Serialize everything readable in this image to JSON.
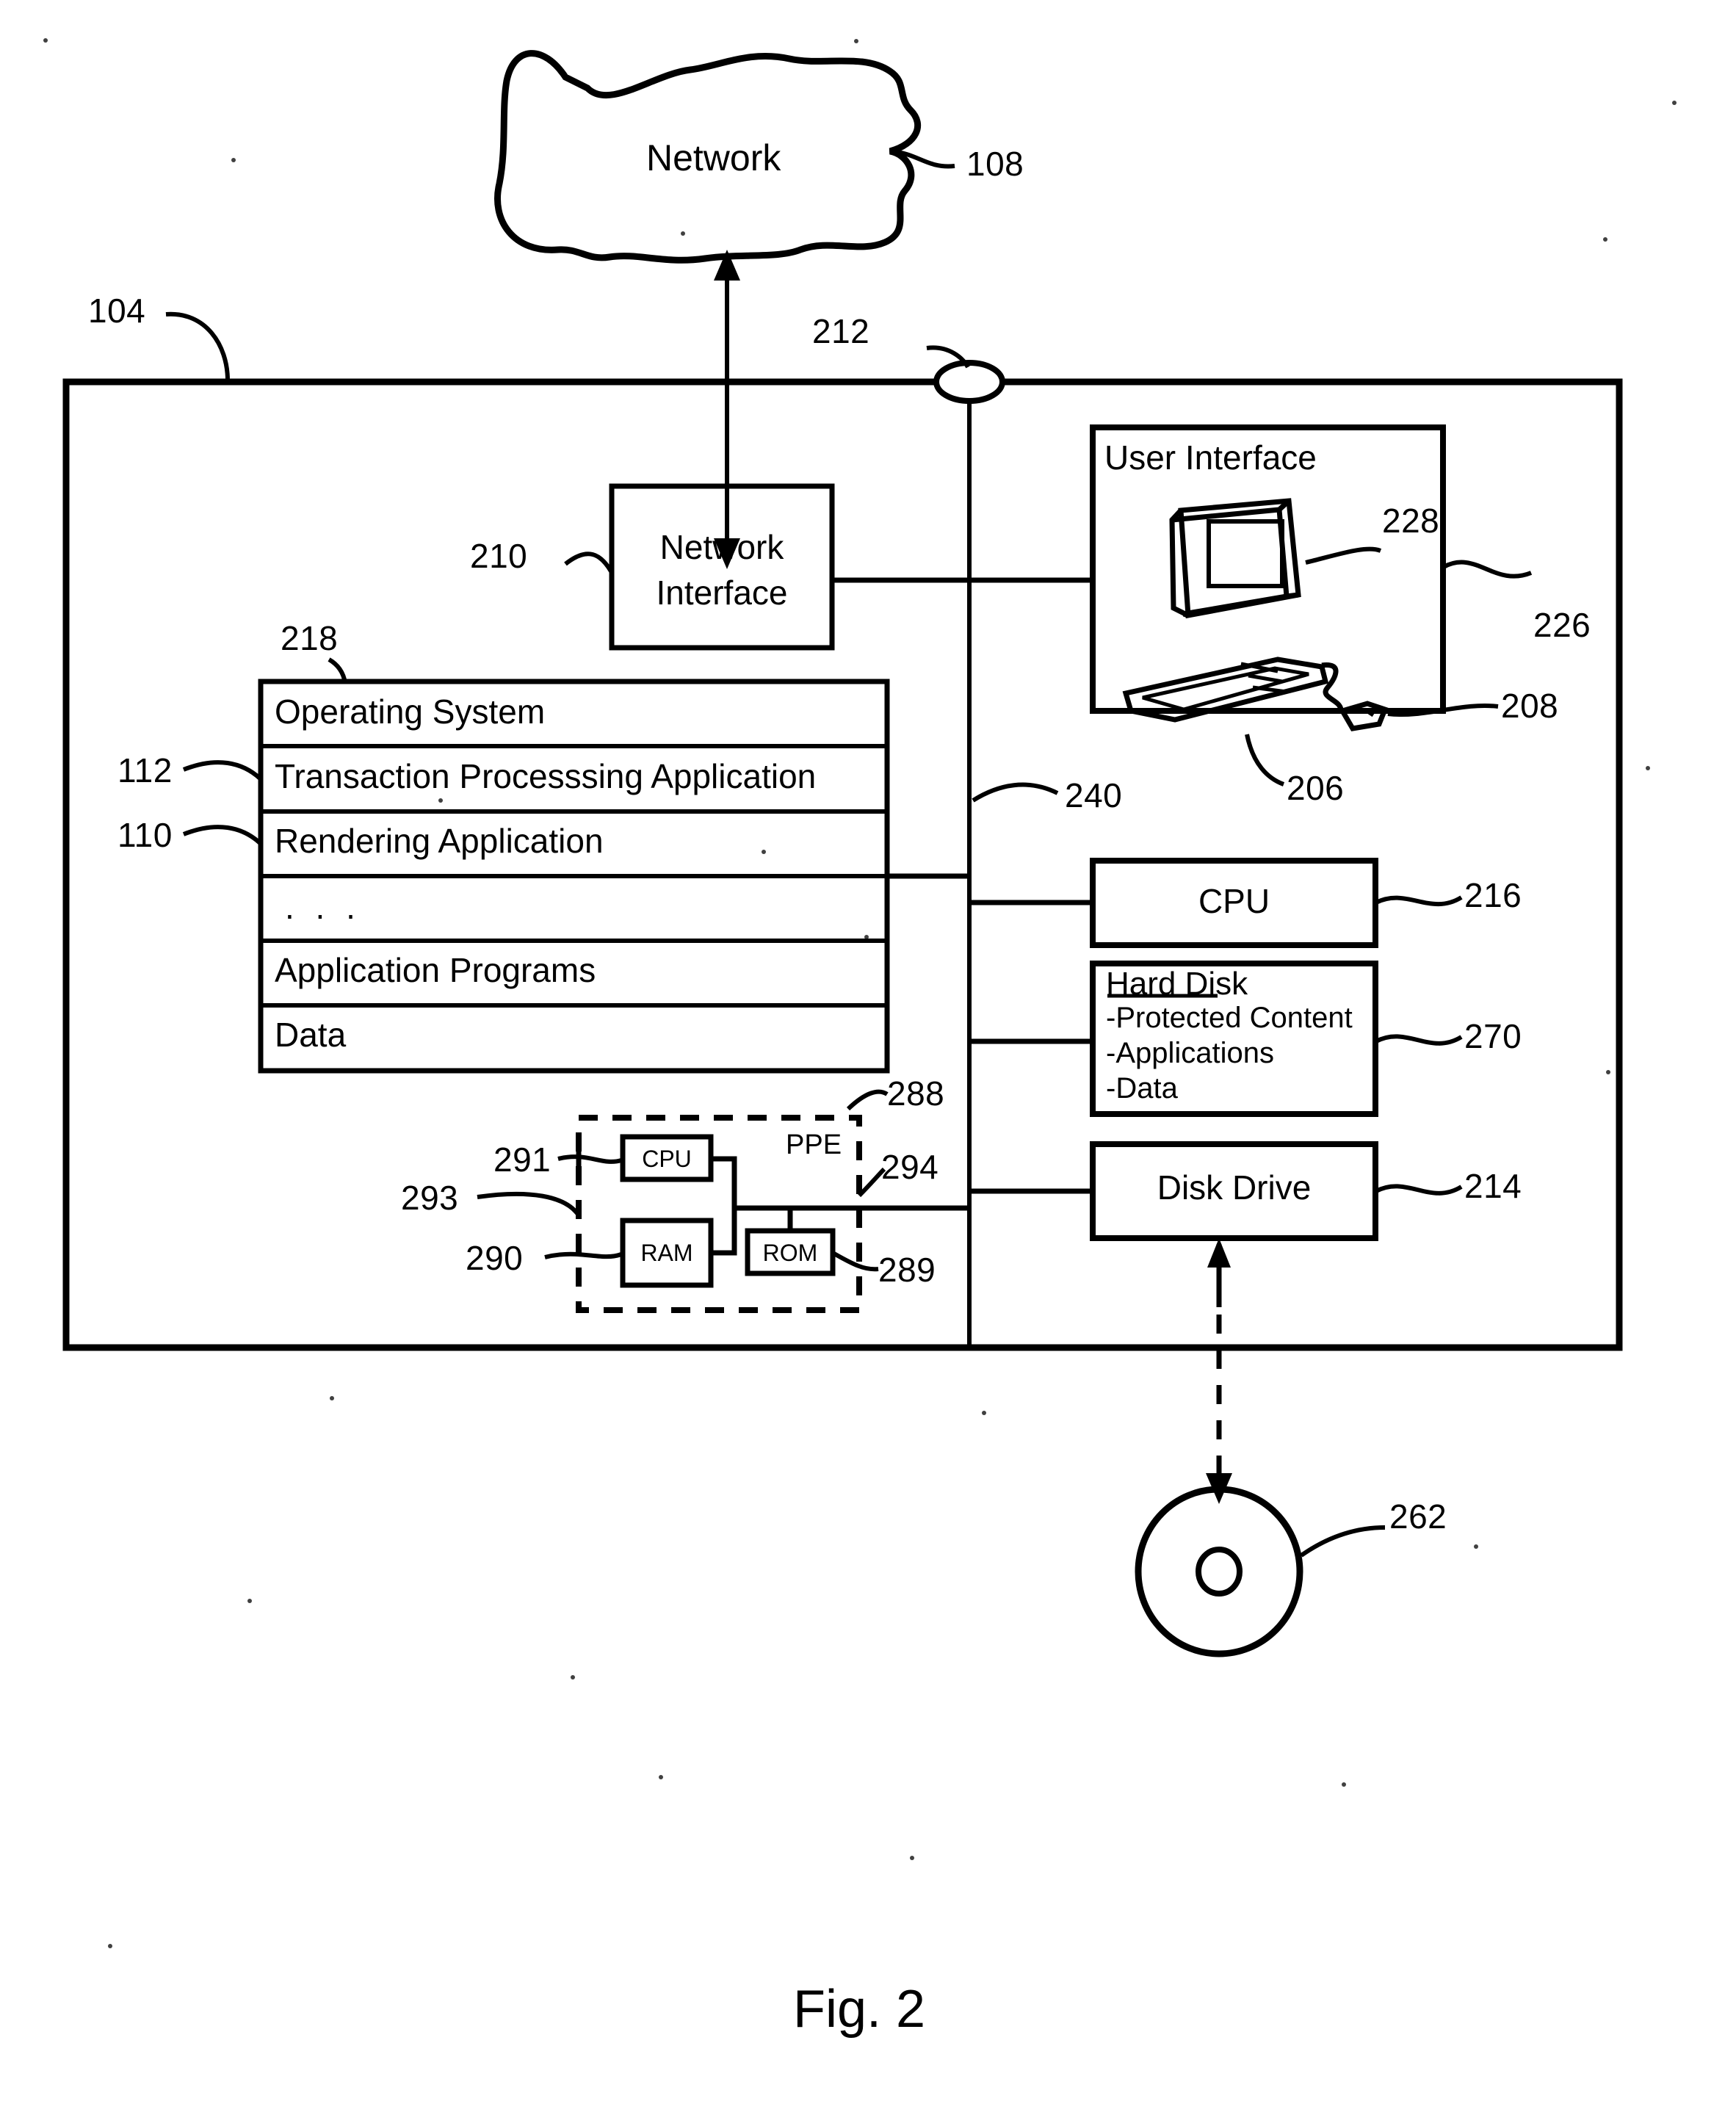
{
  "figure": {
    "caption": "Fig. 2"
  },
  "network_cloud": {
    "label": "Network",
    "ref": "108"
  },
  "system": {
    "ref": "104",
    "bus": {
      "ref": "212",
      "internal_bus_ref": "240"
    }
  },
  "network_interface": {
    "label_line1": "Network",
    "label_line2": "Interface",
    "ref": "210"
  },
  "software_stack": {
    "ref": "218",
    "rows": [
      {
        "label": "Operating System",
        "ref": ""
      },
      {
        "label": "Transaction Processsing Application",
        "ref": "112"
      },
      {
        "label": "Rendering Application",
        "ref": "110"
      },
      {
        "label": ". . .",
        "ref": ""
      },
      {
        "label": "Application Programs",
        "ref": ""
      },
      {
        "label": "Data",
        "ref": ""
      }
    ]
  },
  "ppe": {
    "label": "PPE",
    "ref": "288",
    "bus_ref": "294",
    "internal_bus_ref": "293",
    "cpu": {
      "label": "CPU",
      "ref": "291"
    },
    "ram": {
      "label": "RAM",
      "ref": "290"
    },
    "rom": {
      "label": "ROM",
      "ref": "289"
    }
  },
  "user_interface": {
    "title": "User Interface",
    "ref": "226",
    "monitor_ref": "228",
    "mouse_ref": "208",
    "keyboard_ref": "206"
  },
  "cpu": {
    "label": "CPU",
    "ref": "216"
  },
  "hard_disk": {
    "title": "Hard Disk",
    "items": [
      "-Protected Content",
      "-Applications",
      "-Data"
    ],
    "ref": "270"
  },
  "disk_drive": {
    "label": "Disk Drive",
    "ref": "214"
  },
  "removable_disk": {
    "ref": "262"
  },
  "colors": {
    "ink": "#000000",
    "paper": "#ffffff"
  }
}
